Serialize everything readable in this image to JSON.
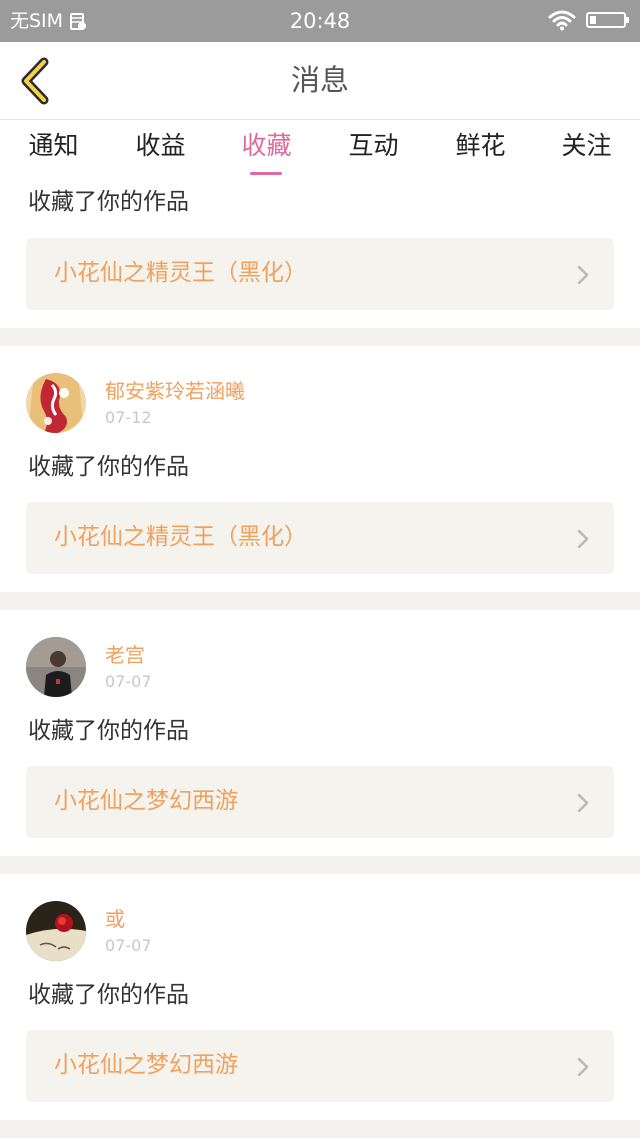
{
  "status_bar": {
    "carrier": "无SIM",
    "time": "20:48",
    "icons": [
      "sim-icon",
      "wifi-icon",
      "battery-icon"
    ]
  },
  "header": {
    "title": "消息",
    "back_icon": "chevron-left-icon"
  },
  "tabs": [
    {
      "label": "通知",
      "active": false
    },
    {
      "label": "收益",
      "active": false
    },
    {
      "label": "收藏",
      "active": true
    },
    {
      "label": "互动",
      "active": false
    },
    {
      "label": "鲜花",
      "active": false
    },
    {
      "label": "关注",
      "active": false
    }
  ],
  "colors": {
    "accent": "#e0699d",
    "username": "#f0a15e",
    "work_title": "#f0a15e",
    "link_bg": "#f4f3ee",
    "status_bar_bg": "#9b9b9b"
  },
  "messages": [
    {
      "user": null,
      "date": null,
      "action": "收藏了你的作品",
      "work": "小花仙之精灵王（黑化）"
    },
    {
      "user": "郁安紫玲若涵曦",
      "date": "07-12",
      "action": "收藏了你的作品",
      "work": "小花仙之精灵王（黑化）"
    },
    {
      "user": "老宫",
      "date": "07-07",
      "action": "收藏了你的作品",
      "work": "小花仙之梦幻西游"
    },
    {
      "user": "或",
      "date": "07-07",
      "action": "收藏了你的作品",
      "work": "小花仙之梦幻西游"
    }
  ]
}
